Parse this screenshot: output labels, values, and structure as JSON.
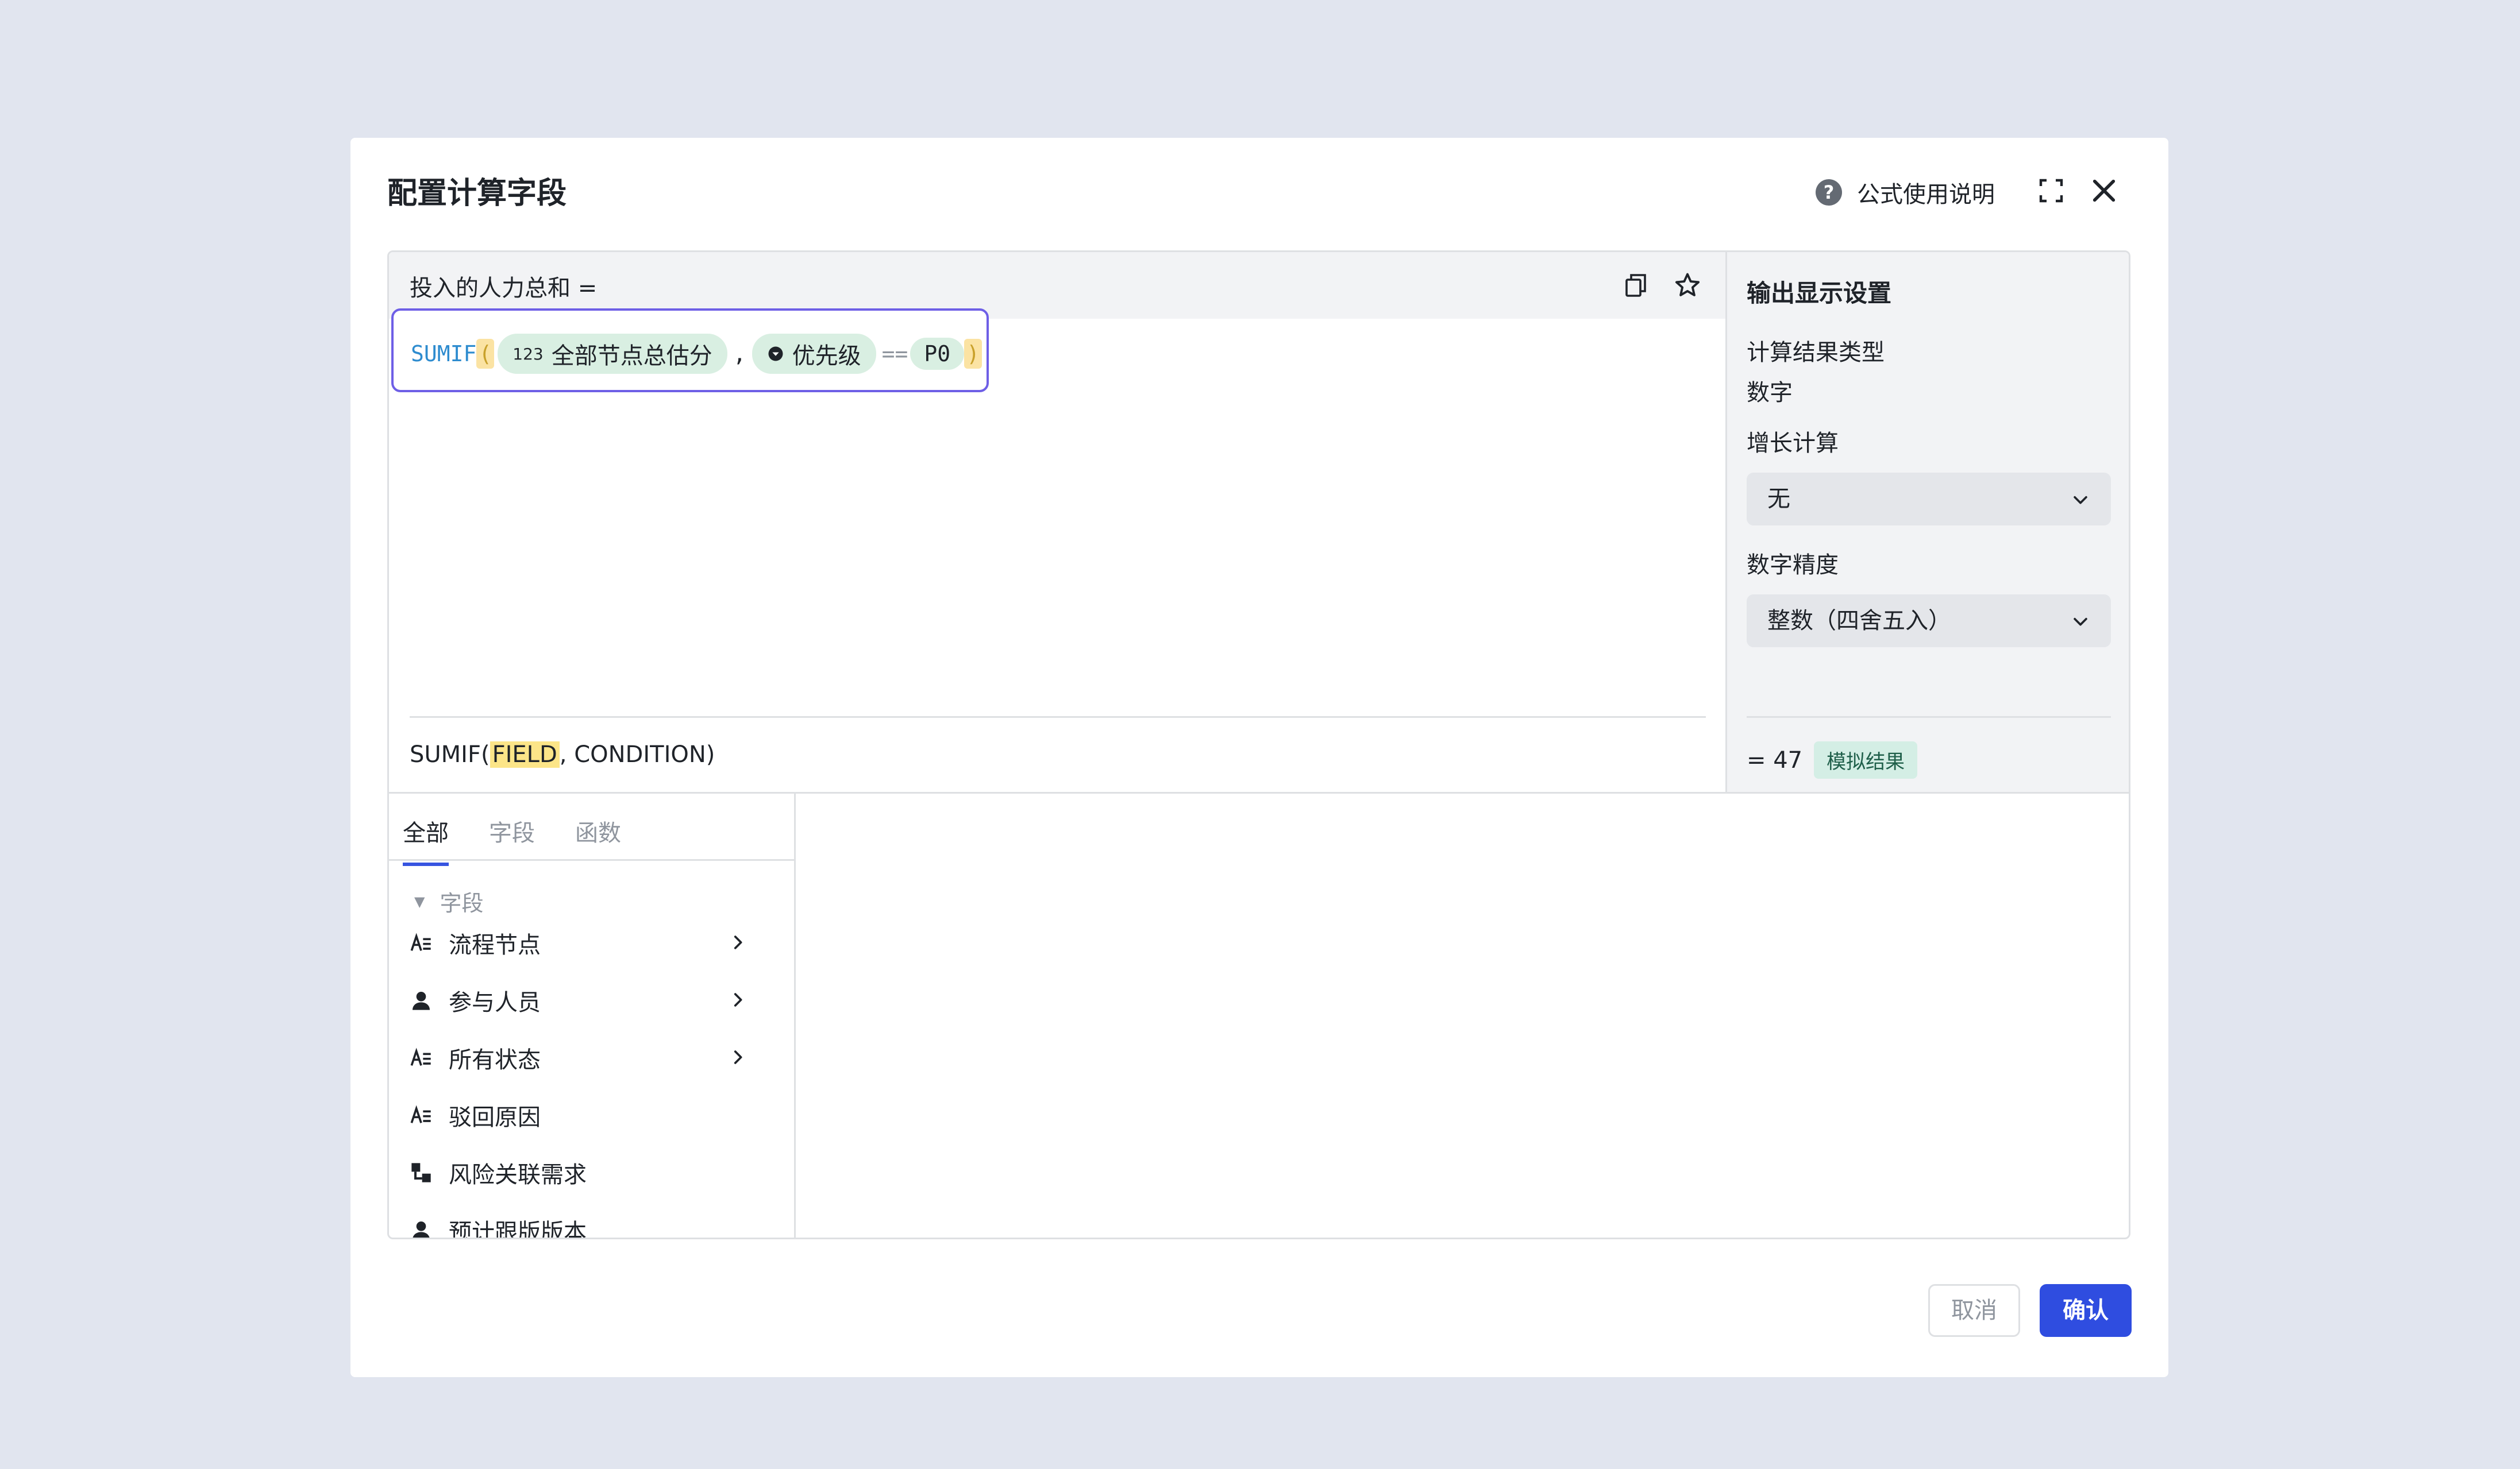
{
  "dialog": {
    "title": "配置计算字段",
    "help_label": "公式使用说明"
  },
  "editor": {
    "field_name": "投入的人力总和 =",
    "formula": {
      "function": "SUMIF",
      "open_paren": "(",
      "field_chip_icon": "123",
      "field_chip": "全部节点总估分",
      "comma": ",",
      "condition_field": "优先级",
      "operator": "==",
      "value": "P0",
      "close_paren": ")"
    },
    "syntax_prefix": "SUMIF(",
    "syntax_highlight": "FIELD",
    "syntax_suffix": ", CONDITION)"
  },
  "output_settings": {
    "title": "输出显示设置",
    "result_type_label": "计算结果类型",
    "result_type_value": "数字",
    "growth_label": "增长计算",
    "growth_value": "无",
    "precision_label": "数字精度",
    "precision_value": "整数（四舍五入）",
    "result_text": "= 47",
    "simulated_badge": "模拟结果"
  },
  "list": {
    "tabs": [
      "全部",
      "字段",
      "函数"
    ],
    "group_label": "字段",
    "items": [
      {
        "label": "流程节点",
        "icon": "text-field-icon"
      },
      {
        "label": "参与人员",
        "icon": "person-icon"
      },
      {
        "label": "所有状态",
        "icon": "text-field-icon"
      },
      {
        "label": "驳回原因",
        "icon": "text-field-icon"
      },
      {
        "label": "风险关联需求",
        "icon": "relation-icon"
      },
      {
        "label": "预计跟版版本",
        "icon": "person-icon"
      }
    ]
  },
  "footer": {
    "cancel": "取消",
    "confirm": "确认"
  },
  "colors": {
    "accent": "#2f4de0",
    "formula_border": "#6e5fe6",
    "chip_bg": "#d9efe2",
    "paren_bg": "#fbe3a3"
  }
}
